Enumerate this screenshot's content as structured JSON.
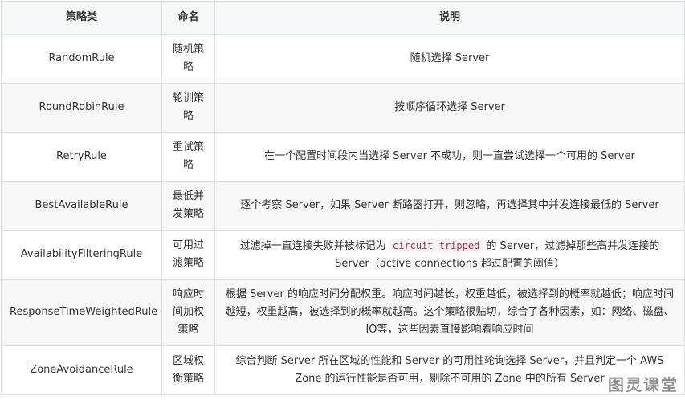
{
  "headers": [
    "策略类",
    "命名",
    "说明"
  ],
  "rows": [
    {
      "cls": "RandomRule",
      "name": "随机策略",
      "desc": "随机选择 Server"
    },
    {
      "cls": "RoundRobinRule",
      "name": "轮训策略",
      "desc": "按顺序循环选择 Server"
    },
    {
      "cls": "RetryRule",
      "name": "重试策略",
      "desc": "在一个配置时间段内当选择 Server 不成功，则一直尝试选择一个可用的 Server"
    },
    {
      "cls": "BestAvailableRule",
      "name": "最低并发策略",
      "desc": "逐个考察 Server，如果 Server 断路器打开，则忽略，再选择其中并发连接最低的 Server"
    },
    {
      "cls": "AvailabilityFilteringRule",
      "name": "可用过滤策略",
      "desc_pre": "过滤掉一直连接失败并被标记为 ",
      "desc_code": "circuit tripped",
      "desc_post": " 的 Server，过滤掉那些高并发连接的 Server（active connections 超过配置的阈值）"
    },
    {
      "cls": "ResponseTimeWeightedRule",
      "name": "响应时间加权策略",
      "desc": "根据 Server 的响应时间分配权重。响应时间越长，权重越低，被选择到的概率就越低；响应时间越短，权重越高，被选择到的概率就越高。这个策略很贴切，综合了各种因素，如：网络、磁盘、IO等，这些因素直接影响着响应时间"
    },
    {
      "cls": "ZoneAvoidanceRule",
      "name": "区域权衡策略",
      "desc": "综合判断 Server 所在区域的性能和 Server 的可用性轮询选择 Server，并且判定一个 AWS Zone 的运行性能是否可用，剔除不可用的 Zone 中的所有 Server"
    }
  ],
  "watermark": "图灵课堂"
}
